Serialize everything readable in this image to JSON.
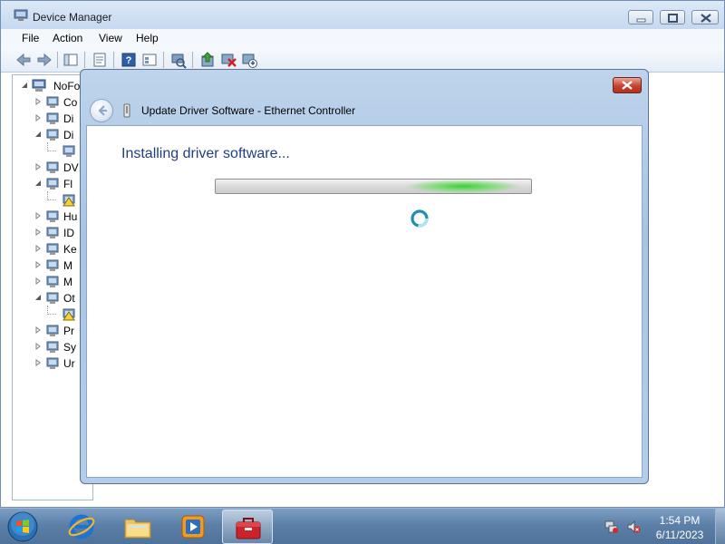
{
  "main_window": {
    "title": "Device Manager",
    "menu": {
      "file": "File",
      "action": "Action",
      "view": "View",
      "help": "Help"
    },
    "toolbar_icons": [
      "back-icon",
      "forward-icon",
      "show-hide-tree-icon",
      "properties-icon",
      "help-icon",
      "view-icon",
      "scan-hardware-icon",
      "update-driver-icon",
      "disable-device-icon",
      "uninstall-device-icon"
    ],
    "tree": {
      "root_label": "NoFo",
      "items": [
        "Co",
        "Di",
        "Di",
        "",
        "DV",
        "Fl",
        "",
        "Hu",
        "ID",
        "Ke",
        "M",
        "M",
        "Ot",
        "",
        "Pr",
        "Sy",
        "Ur"
      ]
    }
  },
  "dialog": {
    "title": "Update Driver Software - Ethernet Controller",
    "heading": "Installing driver software...",
    "progress_glow_center": 0.78
  },
  "taskbar": {
    "time": "1:54 PM",
    "date": "6/11/2023",
    "pinned": [
      "start-orb-icon",
      "internet-explorer-icon",
      "file-explorer-icon",
      "media-player-icon",
      "device-manager-icon"
    ],
    "tray_icons": [
      "network-icon",
      "volume-muted-icon"
    ]
  },
  "colors": {
    "heading_blue": "#1e3e84",
    "progress_green": "#37d13a",
    "close_red": "#c6422f"
  }
}
